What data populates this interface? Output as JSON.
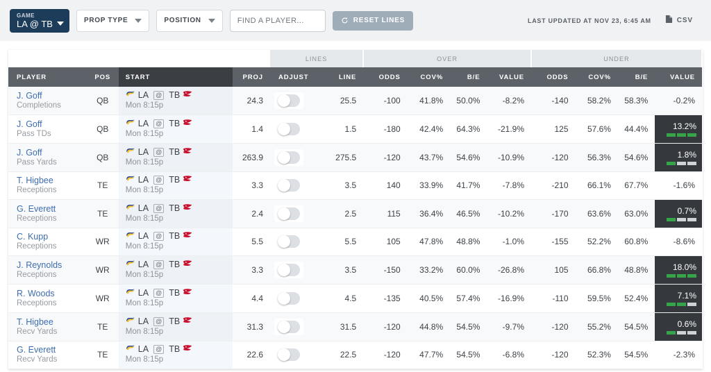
{
  "toolbar": {
    "game": {
      "label": "GAME",
      "value": "LA @ TB"
    },
    "prop_type": {
      "label": "PROP TYPE"
    },
    "position": {
      "label": "POSITION"
    },
    "search": {
      "placeholder": "FIND A PLAYER...",
      "value": ""
    },
    "reset": {
      "label": "RESET LINES",
      "icon": "refresh-icon"
    },
    "last_updated": "LAST UPDATED AT NOV 23, 6:45 AM",
    "csv": {
      "label": "CSV",
      "icon": "document-icon"
    }
  },
  "table": {
    "groups": [
      {
        "label": "",
        "span": 4
      },
      {
        "label": "LINES",
        "span": 2
      },
      {
        "label": "OVER",
        "span": 4
      },
      {
        "label": "UNDER",
        "span": 4
      }
    ],
    "columns": [
      "PLAYER",
      "POS",
      "START",
      "PROJ",
      "ADJUST",
      "LINE",
      "ODDS",
      "COV%",
      "B/E",
      "VALUE",
      "ODDS",
      "COV%",
      "B/E",
      "VALUE"
    ],
    "rows": [
      {
        "player": "J. Goff",
        "prop": "Completions",
        "pos": "QB",
        "away": "LA",
        "home": "TB",
        "at": "@",
        "start": "Mon 8:15p",
        "proj": "24.3",
        "line": "25.5",
        "over": {
          "odds": "-100",
          "cov": "41.8%",
          "be": "50.0%",
          "value": "-8.2%",
          "highlight": false,
          "bars": 0
        },
        "under": {
          "odds": "-140",
          "cov": "58.2%",
          "be": "58.3%",
          "value": "-0.2%",
          "highlight": false,
          "bars": 0
        }
      },
      {
        "player": "J. Goff",
        "prop": "Pass TDs",
        "pos": "QB",
        "away": "LA",
        "home": "TB",
        "at": "@",
        "start": "Mon 8:15p",
        "proj": "1.4",
        "line": "1.5",
        "over": {
          "odds": "-180",
          "cov": "42.4%",
          "be": "64.3%",
          "value": "-21.9%",
          "highlight": false,
          "bars": 0
        },
        "under": {
          "odds": "125",
          "cov": "57.6%",
          "be": "44.4%",
          "value": "13.2%",
          "highlight": true,
          "bars": 3
        }
      },
      {
        "player": "J. Goff",
        "prop": "Pass Yards",
        "pos": "QB",
        "away": "LA",
        "home": "TB",
        "at": "@",
        "start": "Mon 8:15p",
        "proj": "263.9",
        "line": "275.5",
        "over": {
          "odds": "-120",
          "cov": "43.7%",
          "be": "54.6%",
          "value": "-10.9%",
          "highlight": false,
          "bars": 0
        },
        "under": {
          "odds": "-120",
          "cov": "56.3%",
          "be": "54.6%",
          "value": "1.8%",
          "highlight": true,
          "bars": 1
        }
      },
      {
        "player": "T. Higbee",
        "prop": "Receptions",
        "pos": "TE",
        "away": "LA",
        "home": "TB",
        "at": "@",
        "start": "Mon 8:15p",
        "proj": "3.3",
        "line": "3.5",
        "over": {
          "odds": "140",
          "cov": "33.9%",
          "be": "41.7%",
          "value": "-7.8%",
          "highlight": false,
          "bars": 0
        },
        "under": {
          "odds": "-210",
          "cov": "66.1%",
          "be": "67.7%",
          "value": "-1.6%",
          "highlight": false,
          "bars": 0
        }
      },
      {
        "player": "G. Everett",
        "prop": "Receptions",
        "pos": "TE",
        "away": "LA",
        "home": "TB",
        "at": "@",
        "start": "Mon 8:15p",
        "proj": "2.4",
        "line": "2.5",
        "over": {
          "odds": "115",
          "cov": "36.4%",
          "be": "46.5%",
          "value": "-10.2%",
          "highlight": false,
          "bars": 0
        },
        "under": {
          "odds": "-170",
          "cov": "63.6%",
          "be": "63.0%",
          "value": "0.7%",
          "highlight": true,
          "bars": 1
        }
      },
      {
        "player": "C. Kupp",
        "prop": "Receptions",
        "pos": "WR",
        "away": "LA",
        "home": "TB",
        "at": "@",
        "start": "Mon 8:15p",
        "proj": "5.5",
        "line": "5.5",
        "over": {
          "odds": "105",
          "cov": "47.8%",
          "be": "48.8%",
          "value": "-1.0%",
          "highlight": false,
          "bars": 0
        },
        "under": {
          "odds": "-155",
          "cov": "52.2%",
          "be": "60.8%",
          "value": "-8.6%",
          "highlight": false,
          "bars": 0
        }
      },
      {
        "player": "J. Reynolds",
        "prop": "Receptions",
        "pos": "WR",
        "away": "LA",
        "home": "TB",
        "at": "@",
        "start": "Mon 8:15p",
        "proj": "3.3",
        "line": "3.5",
        "over": {
          "odds": "-150",
          "cov": "33.2%",
          "be": "60.0%",
          "value": "-26.8%",
          "highlight": false,
          "bars": 0
        },
        "under": {
          "odds": "105",
          "cov": "66.8%",
          "be": "48.8%",
          "value": "18.0%",
          "highlight": true,
          "bars": 3
        }
      },
      {
        "player": "R. Woods",
        "prop": "Receptions",
        "pos": "WR",
        "away": "LA",
        "home": "TB",
        "at": "@",
        "start": "Mon 8:15p",
        "proj": "4.4",
        "line": "4.5",
        "over": {
          "odds": "-135",
          "cov": "40.5%",
          "be": "57.4%",
          "value": "-16.9%",
          "highlight": false,
          "bars": 0
        },
        "under": {
          "odds": "-110",
          "cov": "59.5%",
          "be": "52.4%",
          "value": "7.1%",
          "highlight": true,
          "bars": 2
        }
      },
      {
        "player": "T. Higbee",
        "prop": "Recv Yards",
        "pos": "TE",
        "away": "LA",
        "home": "TB",
        "at": "@",
        "start": "Mon 8:15p",
        "proj": "31.3",
        "line": "31.5",
        "over": {
          "odds": "-120",
          "cov": "44.8%",
          "be": "54.5%",
          "value": "-9.7%",
          "highlight": false,
          "bars": 0
        },
        "under": {
          "odds": "-120",
          "cov": "55.2%",
          "be": "54.5%",
          "value": "0.6%",
          "highlight": true,
          "bars": 1
        }
      },
      {
        "player": "G. Everett",
        "prop": "Recv Yards",
        "pos": "TE",
        "away": "LA",
        "home": "TB",
        "at": "@",
        "start": "Mon 8:15p",
        "proj": "22.6",
        "line": "22.5",
        "over": {
          "odds": "-120",
          "cov": "47.7%",
          "be": "54.5%",
          "value": "-6.8%",
          "highlight": false,
          "bars": 0
        },
        "under": {
          "odds": "-120",
          "cov": "52.3%",
          "be": "54.5%",
          "value": "-2.3%",
          "highlight": false,
          "bars": 0
        }
      }
    ]
  },
  "colors": {
    "brand_navy": "#1d3c59",
    "header_gray": "#5c6268",
    "start_header": "#3b3f44",
    "highlight_bg": "#35393d",
    "bar_green": "#36a54a",
    "player_link": "#3e6db0"
  }
}
